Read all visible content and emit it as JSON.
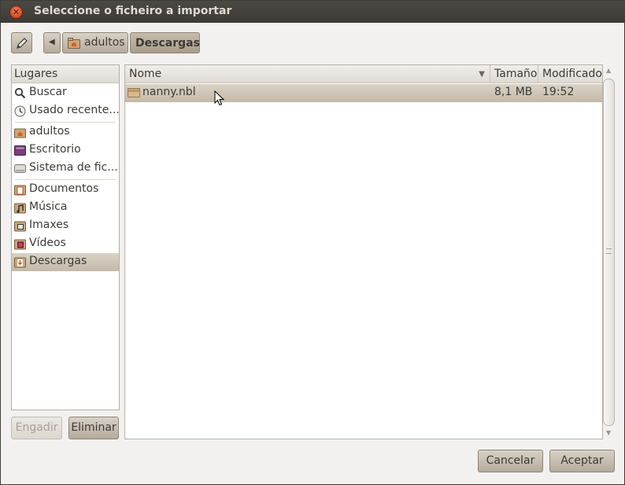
{
  "window": {
    "title": "Seleccione o ficheiro a importar",
    "close_icon": "close-icon"
  },
  "toolbar": {
    "edit_icon": "pencil-icon",
    "back_icon": "arrow-left-icon",
    "breadcrumb": [
      {
        "label": "adultos",
        "icon": "home-folder-icon",
        "active": false
      },
      {
        "label": "Descargas",
        "active": true
      }
    ]
  },
  "places": {
    "header": "Lugares",
    "items": [
      {
        "label": "Buscar",
        "icon": "search-icon"
      },
      {
        "label": "Usado recente...",
        "icon": "clock-icon"
      },
      {
        "label": "adultos",
        "icon": "home-folder-icon"
      },
      {
        "label": "Escritorio",
        "icon": "desktop-icon"
      },
      {
        "label": "Sistema de fic...",
        "icon": "drive-icon"
      },
      {
        "label": "Documentos",
        "icon": "folder-documents-icon"
      },
      {
        "label": "Música",
        "icon": "folder-music-icon"
      },
      {
        "label": "Imaxes",
        "icon": "folder-pictures-icon"
      },
      {
        "label": "Vídeos",
        "icon": "folder-videos-icon"
      },
      {
        "label": "Descargas",
        "icon": "folder-downloads-icon",
        "selected": true
      }
    ],
    "add_label": "Engadir",
    "remove_label": "Eliminar"
  },
  "files": {
    "columns": {
      "name": "Nome",
      "size": "Tamaño",
      "modified": "Modificado"
    },
    "sort_icon": "sort-down-icon",
    "rows": [
      {
        "name": "nanny.nbl",
        "size": "8,1 MB",
        "modified": "19:52",
        "icon": "package-icon",
        "selected": true
      }
    ]
  },
  "actions": {
    "cancel_label": "Cancelar",
    "accept_label": "Aceptar"
  },
  "colors": {
    "accent_selected": "#c4b9a8",
    "titlebar": "#3c3b37",
    "close_button": "#df4a16"
  }
}
